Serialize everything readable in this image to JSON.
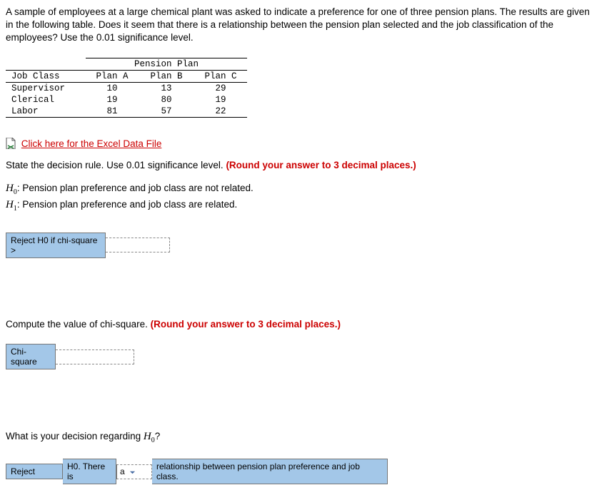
{
  "intro": "A sample of employees at a large chemical plant was asked to indicate a preference for one of three pension plans. The results are given in the following table. Does it seem that there is a relationship between the pension plan selected and the job classification of the employees? Use the 0.01 significance level.",
  "table": {
    "group_header": "Pension Plan",
    "row_header": "Job Class",
    "cols": [
      "Plan A",
      "Plan B",
      "Plan C"
    ],
    "rows": [
      {
        "label": "Supervisor",
        "vals": [
          "10",
          "13",
          "29"
        ]
      },
      {
        "label": "Clerical",
        "vals": [
          "19",
          "80",
          "19"
        ]
      },
      {
        "label": "Labor",
        "vals": [
          "81",
          "57",
          "22"
        ]
      }
    ]
  },
  "excel_link": "Click here for the Excel Data File",
  "q1": {
    "prompt_a": "State the decision rule. Use 0.01 significance level. ",
    "prompt_b": "(Round your answer to 3 decimal places.)",
    "h0": ": Pension plan preference and job class are not related.",
    "h1": ": Pension plan preference and job class are related.",
    "label": "Reject H0 if chi-square >",
    "value": ""
  },
  "q2": {
    "prompt_a": "Compute the value of chi-square. ",
    "prompt_b": "(Round your answer to 3 decimal places.)",
    "label": "Chi-square",
    "value": ""
  },
  "q3": {
    "prompt": "What is your decision regarding ",
    "h0_sym": "H",
    "cell1": "Reject",
    "cell2": "H0. There is",
    "select_value": "a",
    "cell3": "relationship between pension plan preference and job class."
  }
}
